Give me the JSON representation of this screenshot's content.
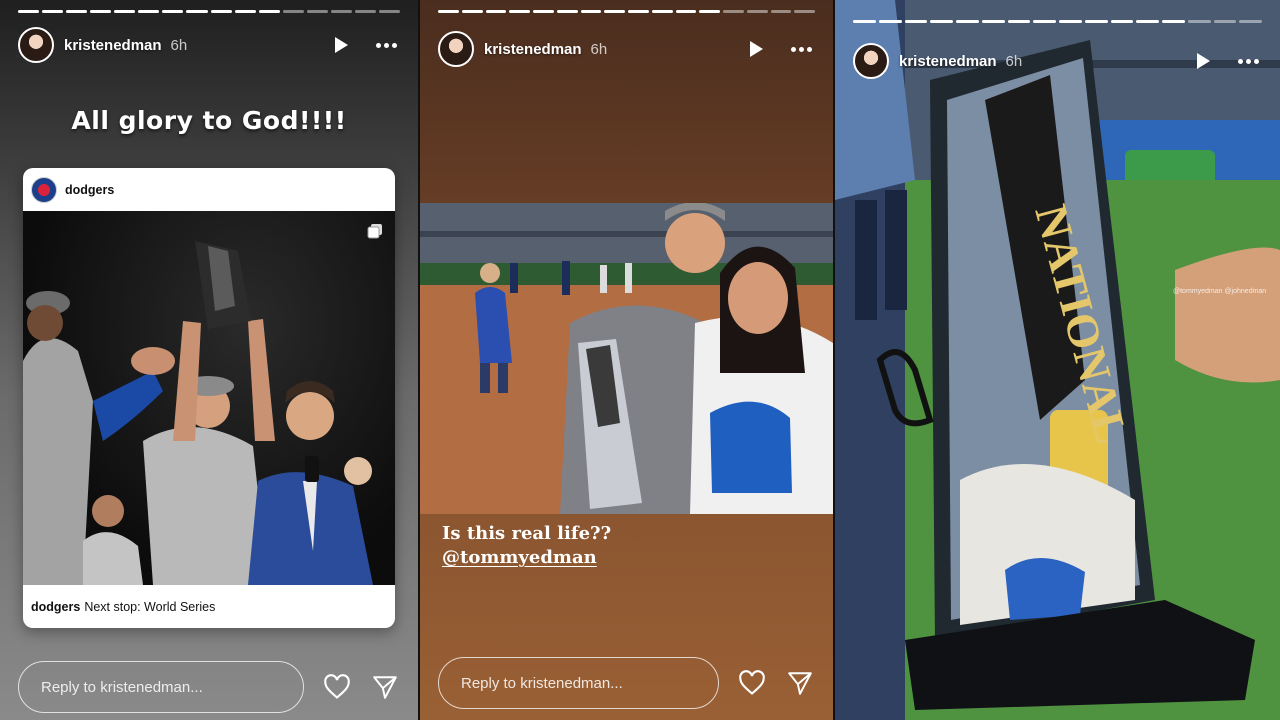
{
  "stories": [
    {
      "username": "kristenedman",
      "time": "6h",
      "caption": "All glory to God!!!!",
      "post": {
        "account": "dodgers",
        "caption_account": "dodgers",
        "caption_text": "Next stop: World Series"
      },
      "reply_placeholder": "Reply to kristenedman..."
    },
    {
      "username": "kristenedman",
      "time": "6h",
      "caption_line1": "Is this real life??",
      "mention": "@tommyedman",
      "reply_placeholder": "Reply to kristenedman..."
    },
    {
      "username": "kristenedman",
      "time": "6h",
      "photo_tags": "@tommyedman @johnedman",
      "trophy_text": "NATIONAL"
    }
  ],
  "colors": {
    "text": "#ffffff",
    "card_bg": "#ffffff"
  },
  "icons": [
    "play-icon",
    "more-icon",
    "heart-icon",
    "send-icon",
    "carousel-icon"
  ]
}
